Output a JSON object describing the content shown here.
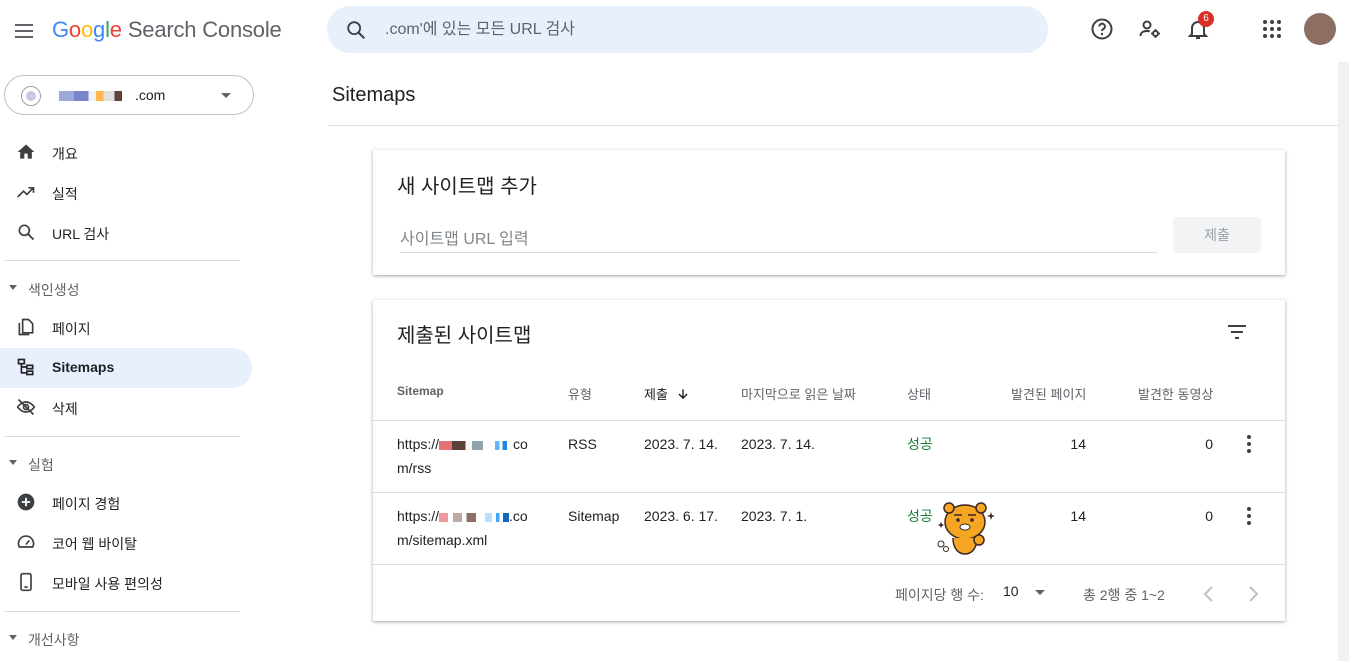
{
  "header": {
    "logo_google": [
      "G",
      "o",
      "o",
      "g",
      "l",
      "e"
    ],
    "product": "Search Console",
    "search_placeholder": ".com'에 있는 모든 URL 검사",
    "notification_count": "6"
  },
  "sidebar": {
    "property": ".com",
    "items_top": [
      {
        "label": "개요",
        "icon": "home-icon"
      },
      {
        "label": "실적",
        "icon": "trending-up-icon"
      },
      {
        "label": "URL 검사",
        "icon": "search-icon"
      }
    ],
    "section_indexing": "색인생성",
    "items_indexing": [
      {
        "label": "페이지",
        "icon": "pages-icon"
      },
      {
        "label": "Sitemaps",
        "icon": "sitemap-icon",
        "active": true
      },
      {
        "label": "삭제",
        "icon": "removal-icon"
      }
    ],
    "section_experience": "실험",
    "items_experience": [
      {
        "label": "페이지 경험",
        "icon": "plus-circle-icon"
      },
      {
        "label": "코어 웹 바이탈",
        "icon": "speed-icon"
      },
      {
        "label": "모바일 사용 편의성",
        "icon": "phone-icon"
      }
    ],
    "section_enhancements": "개선사항"
  },
  "main": {
    "page_title": "Sitemaps",
    "add_card": {
      "title": "새 사이트맵 추가",
      "input_placeholder": "사이트맵 URL 입력",
      "submit_label": "제출"
    },
    "list_card": {
      "title": "제출된 사이트맵",
      "columns": [
        "Sitemap",
        "유형",
        "제출",
        "마지막으로 읽은 날짜",
        "상태",
        "발견된 페이지",
        "발견한 동영상"
      ],
      "rows": [
        {
          "url_prefix": "https://",
          "url_suffix1": "co",
          "url_suffix2": "m/rss",
          "type": "RSS",
          "submitted": "2023. 7. 14.",
          "last_read": "2023. 7. 14.",
          "status": "성공",
          "pages": "14",
          "videos": "0"
        },
        {
          "url_prefix": "https://",
          "url_suffix1": ".co",
          "url_suffix2": "m/sitemap.xml",
          "type": "Sitemap",
          "submitted": "2023. 6. 17.",
          "last_read": "2023. 7. 1.",
          "status": "성공",
          "pages": "14",
          "videos": "0"
        }
      ],
      "rows_per_page_label": "페이지당 행 수:",
      "rows_per_page": "10",
      "range_label": "총 2행 중 1~2"
    }
  },
  "colors": {
    "accent_blue": "#1a73e8",
    "active_bg": "#e8f0fe",
    "success": "#188038",
    "badge_red": "#d93025"
  }
}
